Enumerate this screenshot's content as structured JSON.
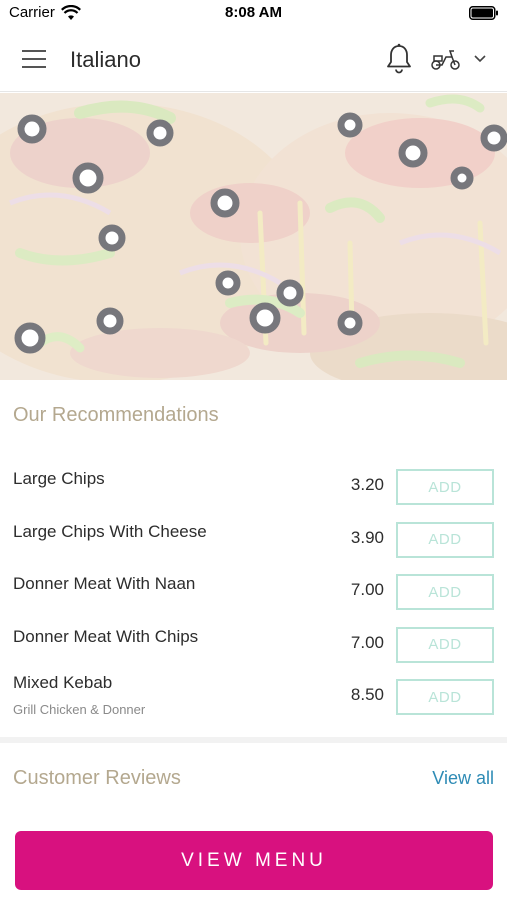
{
  "status_bar": {
    "carrier": "Carrier",
    "time": "8:08 AM"
  },
  "header": {
    "title": "Italiano",
    "icons": [
      "menu-icon",
      "bell-icon",
      "scooter-icon",
      "chevron-down-icon"
    ]
  },
  "recommendations": {
    "title": "Our Recommendations",
    "items": [
      {
        "name": "Large Chips",
        "subtitle": "",
        "price": "3.20",
        "add_label": "ADD"
      },
      {
        "name": "Large Chips With Cheese",
        "subtitle": "",
        "price": "3.90",
        "add_label": "ADD"
      },
      {
        "name": "Donner Meat With Naan",
        "subtitle": "",
        "price": "7.00",
        "add_label": "ADD"
      },
      {
        "name": "Donner Meat With Chips",
        "subtitle": "",
        "price": "7.00",
        "add_label": "ADD"
      },
      {
        "name": "Mixed Kebab",
        "subtitle": "Grill Chicken & Donner",
        "price": "8.50",
        "add_label": "ADD"
      }
    ]
  },
  "reviews": {
    "title": "Customer Reviews",
    "view_all": "View all"
  },
  "cta": {
    "label": "VIEW MENU"
  },
  "colors": {
    "accent": "#d8117f",
    "section_title": "#b4a88f",
    "add_button": "#b9e4d8",
    "link": "#2e8bb5"
  }
}
